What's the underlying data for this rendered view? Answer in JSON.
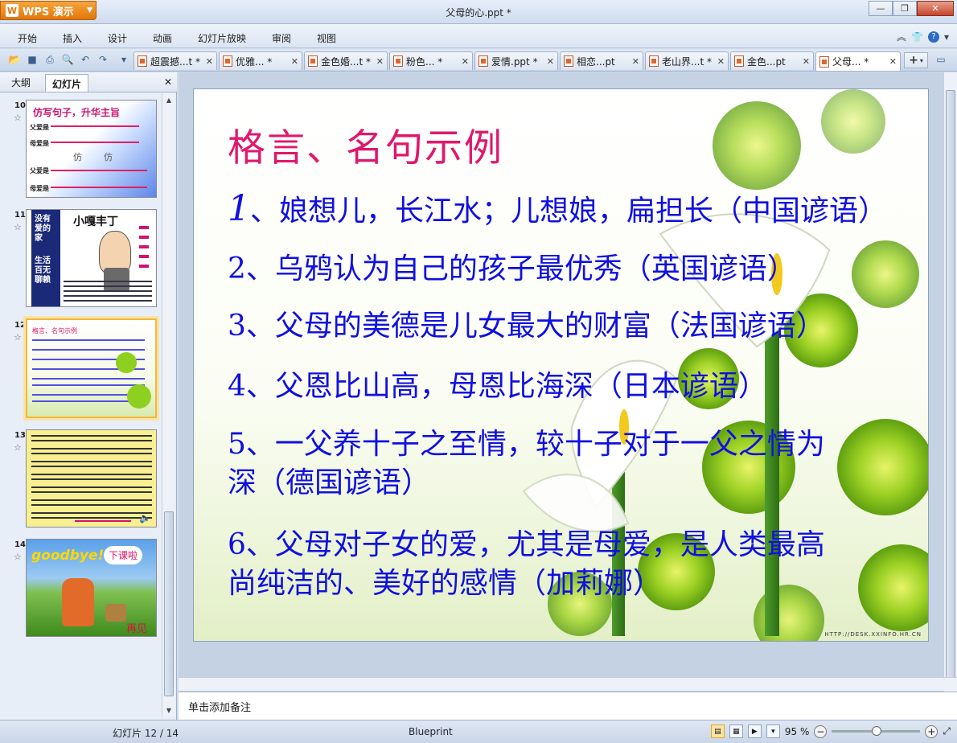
{
  "app": {
    "button_label": "WPS 演示",
    "title": "父母的心.ppt *"
  },
  "menu": [
    "开始",
    "插入",
    "设计",
    "动画",
    "幻灯片放映",
    "审阅",
    "视图"
  ],
  "doc_tabs": [
    {
      "label": "超震撼...t *",
      "active": false
    },
    {
      "label": "优雅... *",
      "active": false
    },
    {
      "label": "金色婚...t *",
      "active": false
    },
    {
      "label": "粉色... *",
      "active": false
    },
    {
      "label": "爱情.ppt *",
      "active": false
    },
    {
      "label": "相恋...pt",
      "active": false
    },
    {
      "label": "老山界...t *",
      "active": false
    },
    {
      "label": "金色...pt",
      "active": false
    },
    {
      "label": "父母... *",
      "active": true
    }
  ],
  "panel": {
    "tab_outline": "大纲",
    "tab_slides": "幻灯片"
  },
  "thumbnails": [
    {
      "num": "10",
      "title": "仿写句子，升华主旨",
      "lines": [
        "父爱是",
        "母爱是",
        "仿",
        "仿"
      ]
    },
    {
      "num": "11",
      "title": "小嘎丰丁",
      "lines": [
        "没有爱的家",
        "生活百无聊赖"
      ]
    },
    {
      "num": "12",
      "title": "格言、名句示例",
      "lines": []
    },
    {
      "num": "13",
      "title": "",
      "lines": []
    },
    {
      "num": "14",
      "title": "goodbye!",
      "lines": [
        "下课啦",
        "再见"
      ]
    }
  ],
  "slide": {
    "title": "格言、名句示例",
    "items": [
      {
        "num": "1",
        "text": "、娘想儿，长江水；儿想娘，扁担长（中国谚语）"
      },
      {
        "num": "",
        "text": "2、乌鸦认为自己的孩子最优秀（英国谚语）"
      },
      {
        "num": "",
        "text": "3、父母的美德是儿女最大的财富（法国谚语）"
      },
      {
        "num": "",
        "text": "4、父恩比山高，母恩比海深（日本谚语）"
      },
      {
        "num": "",
        "text": "5、一父养十子之至情，较十子对于一父之情为"
      },
      {
        "num": "",
        "text": "深（德国谚语）"
      },
      {
        "num": "",
        "text": "6、父母对子女的爱，尤其是母爱，是人类最高"
      },
      {
        "num": "",
        "text": "尚纯洁的、美好的感情（加莉娜）"
      }
    ],
    "watermark": "HTTP://DESK.XXINFO.HR.CN"
  },
  "notes_placeholder": "单击添加备注",
  "status": {
    "slide_counter": "幻灯片 12 / 14",
    "theme": "Blueprint",
    "zoom": "95 %"
  }
}
